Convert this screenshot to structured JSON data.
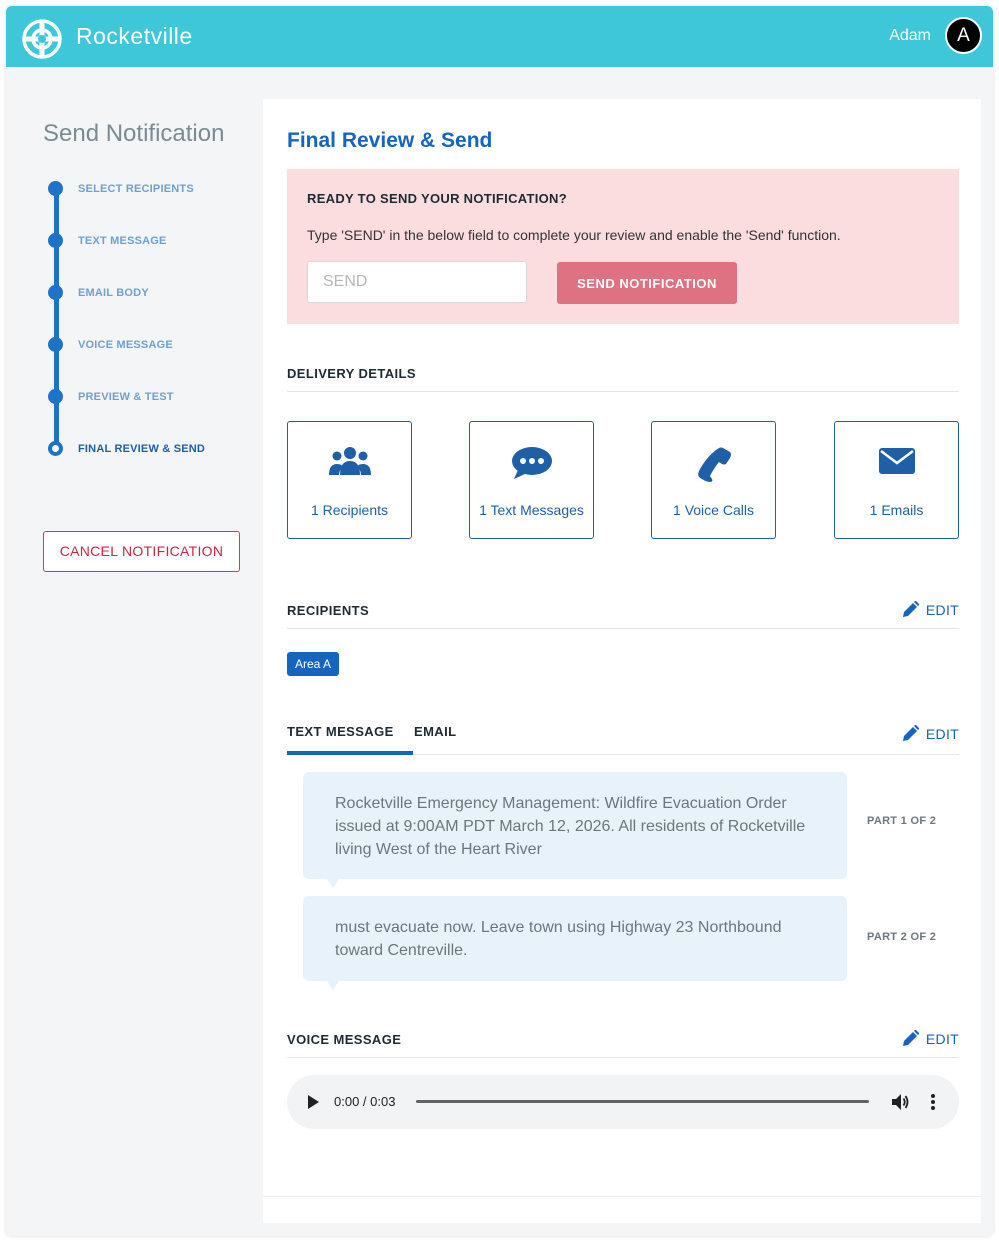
{
  "app": {
    "title": "Rocketville"
  },
  "user": {
    "name": "Adam",
    "initial": "A"
  },
  "sidebar": {
    "title": "Send Notification",
    "steps": [
      {
        "label": "SELECT RECIPIENTS"
      },
      {
        "label": "TEXT MESSAGE"
      },
      {
        "label": "EMAIL BODY"
      },
      {
        "label": "VOICE MESSAGE"
      },
      {
        "label": "PREVIEW & TEST"
      },
      {
        "label": "FINAL REVIEW & SEND"
      }
    ],
    "current_step": "FINAL REVIEW & SEND",
    "cancel_label": "CANCEL NOTIFICATION"
  },
  "main": {
    "title": "Final Review & Send",
    "send_box": {
      "heading": "READY TO SEND YOUR NOTIFICATION?",
      "description": "Type 'SEND' in the below field to complete your review and enable the 'Send' function.",
      "input_value": "",
      "input_placeholder": "SEND",
      "button_label": "SEND NOTIFICATION"
    },
    "delivery": {
      "heading": "DELIVERY DETAILS",
      "cards": [
        {
          "icon": "users-icon",
          "label": "1 Recipients"
        },
        {
          "icon": "chat-bubble-icon",
          "label": "1 Text Messages"
        },
        {
          "icon": "phone-icon",
          "label": "1 Voice Calls"
        },
        {
          "icon": "envelope-icon",
          "label": "1 Emails"
        }
      ]
    },
    "recipients": {
      "heading": "RECIPIENTS",
      "edit_label": "EDIT",
      "tags": [
        "Area A"
      ]
    },
    "message_tabs": {
      "tabs": [
        "TEXT MESSAGE",
        "EMAIL"
      ],
      "active_tab": "TEXT MESSAGE",
      "edit_label": "EDIT",
      "parts": [
        {
          "text": "Rocketville Emergency Management: Wildfire Evacuation Order issued at 9:00AM PDT March 12, 2026. All residents of Rocketville living West of the Heart River",
          "label": "PART 1 OF 2"
        },
        {
          "text": "must evacuate now. Leave town using Highway 23 Northbound toward Centreville.",
          "label": "PART 2 OF 2"
        }
      ]
    },
    "voice": {
      "heading": "VOICE MESSAGE",
      "edit_label": "EDIT",
      "time": "0:00 / 0:03",
      "progress": 0
    }
  },
  "colors": {
    "topbar": "#3ec7d8",
    "primary": "#1565c0",
    "alert_bg": "#fbdde0",
    "send_button": "#de7282",
    "cancel": "#d0253f"
  }
}
